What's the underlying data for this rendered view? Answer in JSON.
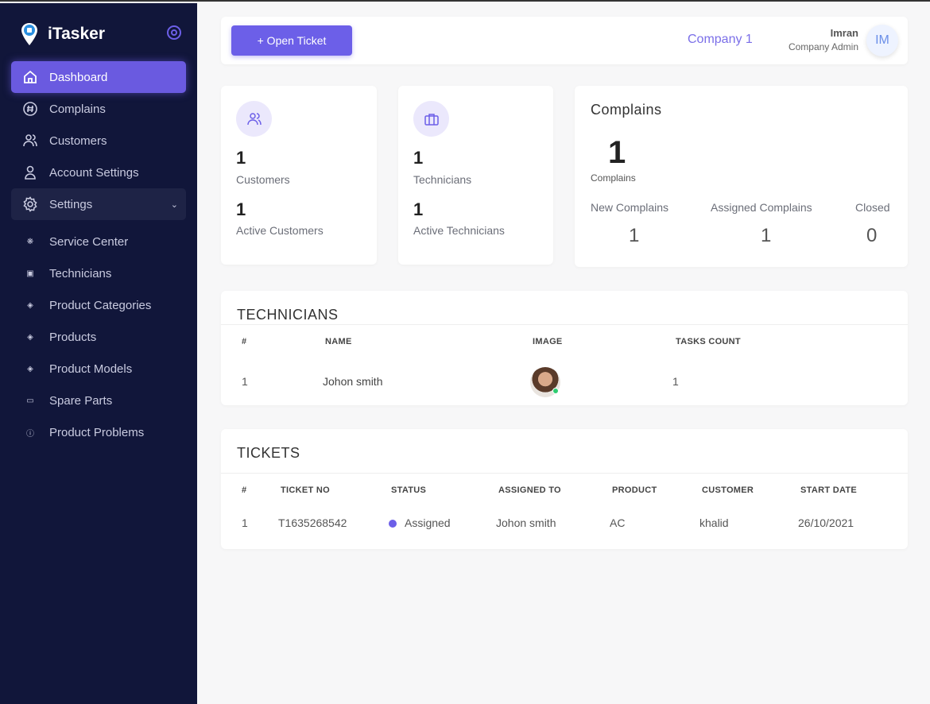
{
  "app": {
    "name": "iTasker"
  },
  "sidebar": {
    "items": [
      {
        "label": "Dashboard"
      },
      {
        "label": "Complains"
      },
      {
        "label": "Customers"
      },
      {
        "label": "Account Settings"
      },
      {
        "label": "Settings"
      }
    ],
    "sub_items": [
      {
        "label": "Service Center"
      },
      {
        "label": "Technicians"
      },
      {
        "label": "Product Categories"
      },
      {
        "label": "Products"
      },
      {
        "label": "Product Models"
      },
      {
        "label": "Spare Parts"
      },
      {
        "label": "Product Problems"
      }
    ]
  },
  "header": {
    "open_ticket": "+ Open Ticket",
    "company": "Company 1",
    "user_name": "Imran",
    "user_role": "Company Admin",
    "avatar_initials": "IM"
  },
  "stats": {
    "customers": {
      "count": "1",
      "label": "Customers",
      "active_count": "1",
      "active_label": "Active Customers"
    },
    "technicians": {
      "count": "1",
      "label": "Technicians",
      "active_count": "1",
      "active_label": "Active Technicians"
    },
    "complains": {
      "title": "Complains",
      "count": "1",
      "count_label": "Complains",
      "new_label": "New Complains",
      "new": "1",
      "assigned_label": "Assigned Complains",
      "assigned": "1",
      "closed_label": "Closed",
      "closed": "0"
    }
  },
  "technicians": {
    "title": "TECHNICIANS",
    "columns": [
      "#",
      "NAME",
      "IMAGE",
      "TASKS COUNT"
    ],
    "rows": [
      {
        "num": "1",
        "name": "Johon smith",
        "tasks": "1"
      }
    ]
  },
  "tickets": {
    "title": "TICKETS",
    "columns": [
      "#",
      "TICKET NO",
      "STATUS",
      "ASSIGNED TO",
      "PRODUCT",
      "CUSTOMER",
      "START DATE"
    ],
    "rows": [
      {
        "num": "1",
        "ticket_no": "T1635268542",
        "status": "Assigned",
        "assigned_to": "Johon smith",
        "product": "AC",
        "customer": "khalid",
        "start_date": "26/10/2021"
      }
    ]
  },
  "colors": {
    "accent": "#6c5fe8",
    "sidebar": "#11163a"
  }
}
